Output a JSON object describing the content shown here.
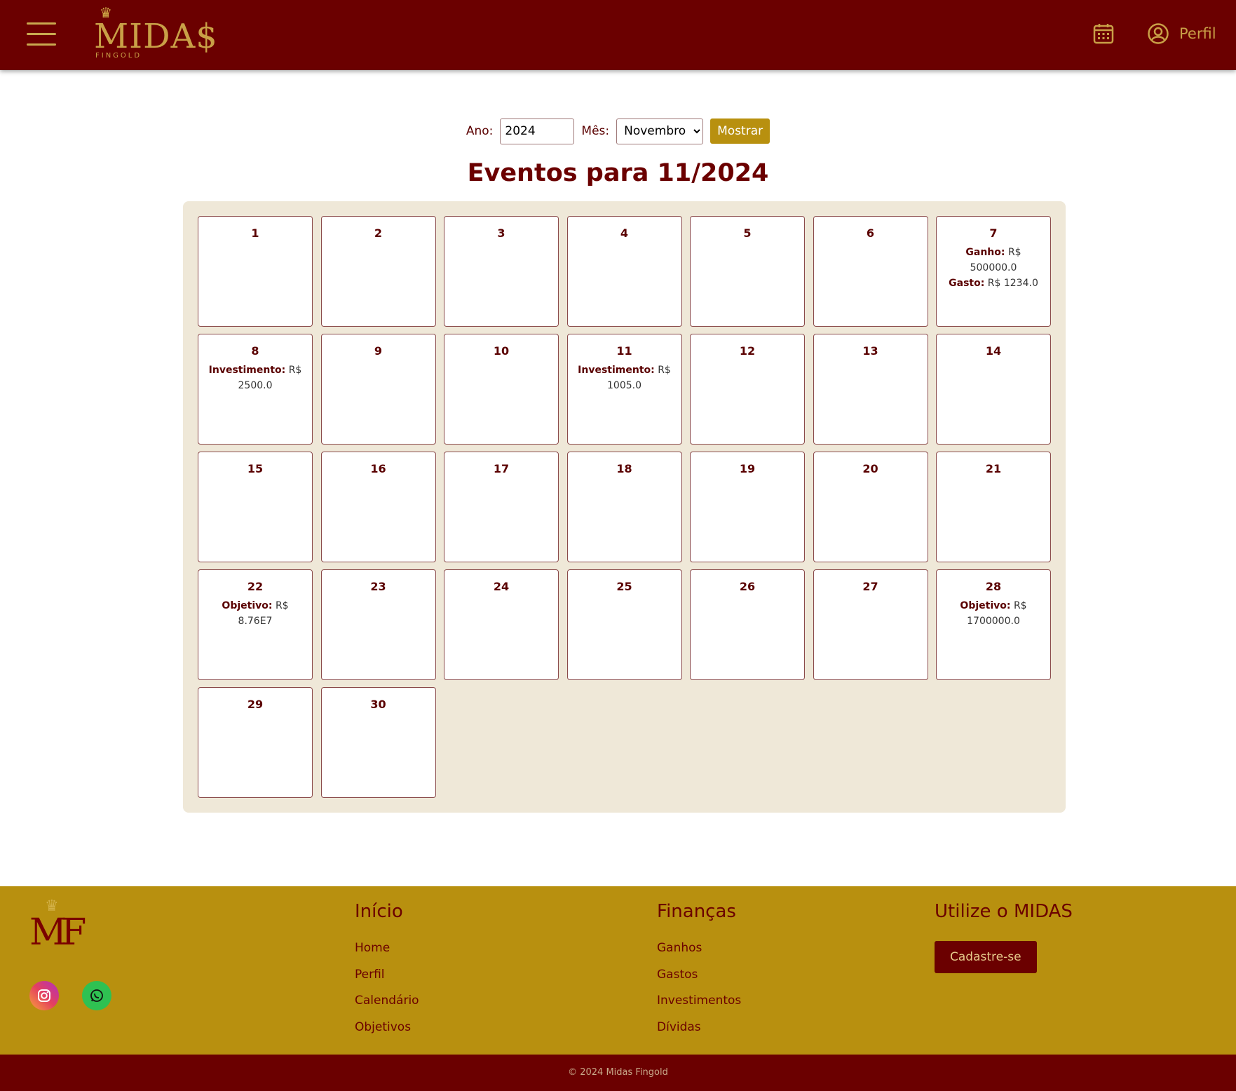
{
  "header": {
    "logo_text": "MIDA$",
    "logo_sub": "FINGOLD",
    "profile_label": "Perfil",
    "colors": {
      "bar": "#6b0000",
      "gold": "#c9a047"
    }
  },
  "filter": {
    "year_label": "Ano:",
    "year_value": "2024",
    "month_label": "Mês:",
    "month_value": "Novembro",
    "show_label": "Mostrar"
  },
  "page_title": "Eventos para 11/2024",
  "calendar": {
    "days": [
      {
        "n": "1",
        "events": []
      },
      {
        "n": "2",
        "events": []
      },
      {
        "n": "3",
        "events": []
      },
      {
        "n": "4",
        "events": []
      },
      {
        "n": "5",
        "events": []
      },
      {
        "n": "6",
        "events": []
      },
      {
        "n": "7",
        "events": [
          {
            "label": "Ganho:",
            "value": "R$ 500000.0"
          },
          {
            "label": "Gasto:",
            "value": "R$ 1234.0"
          }
        ]
      },
      {
        "n": "8",
        "events": [
          {
            "label": "Investimento:",
            "value": "R$ 2500.0"
          }
        ]
      },
      {
        "n": "9",
        "events": []
      },
      {
        "n": "10",
        "events": []
      },
      {
        "n": "11",
        "events": [
          {
            "label": "Investimento:",
            "value": "R$ 1005.0"
          }
        ]
      },
      {
        "n": "12",
        "events": []
      },
      {
        "n": "13",
        "events": []
      },
      {
        "n": "14",
        "events": []
      },
      {
        "n": "15",
        "events": []
      },
      {
        "n": "16",
        "events": []
      },
      {
        "n": "17",
        "events": []
      },
      {
        "n": "18",
        "events": []
      },
      {
        "n": "19",
        "events": []
      },
      {
        "n": "20",
        "events": []
      },
      {
        "n": "21",
        "events": []
      },
      {
        "n": "22",
        "events": [
          {
            "label": "Objetivo:",
            "value": "R$ 8.76E7"
          }
        ]
      },
      {
        "n": "23",
        "events": []
      },
      {
        "n": "24",
        "events": []
      },
      {
        "n": "25",
        "events": []
      },
      {
        "n": "26",
        "events": []
      },
      {
        "n": "27",
        "events": []
      },
      {
        "n": "28",
        "events": [
          {
            "label": "Objetivo:",
            "value": "R$ 1700000.0"
          }
        ]
      },
      {
        "n": "29",
        "events": []
      },
      {
        "n": "30",
        "events": []
      }
    ]
  },
  "footer": {
    "logo_text": "MF",
    "col1": {
      "title": "Início",
      "links": [
        "Home",
        "Perfil",
        "Calendário",
        "Objetivos"
      ]
    },
    "col2": {
      "title": "Finanças",
      "links": [
        "Ganhos",
        "Gastos",
        "Investimentos",
        "Dívidas"
      ]
    },
    "col3": {
      "title": "Utilize o MIDAS",
      "button": "Cadastre-se"
    },
    "copyright": "© 2024 Midas Fingold"
  }
}
